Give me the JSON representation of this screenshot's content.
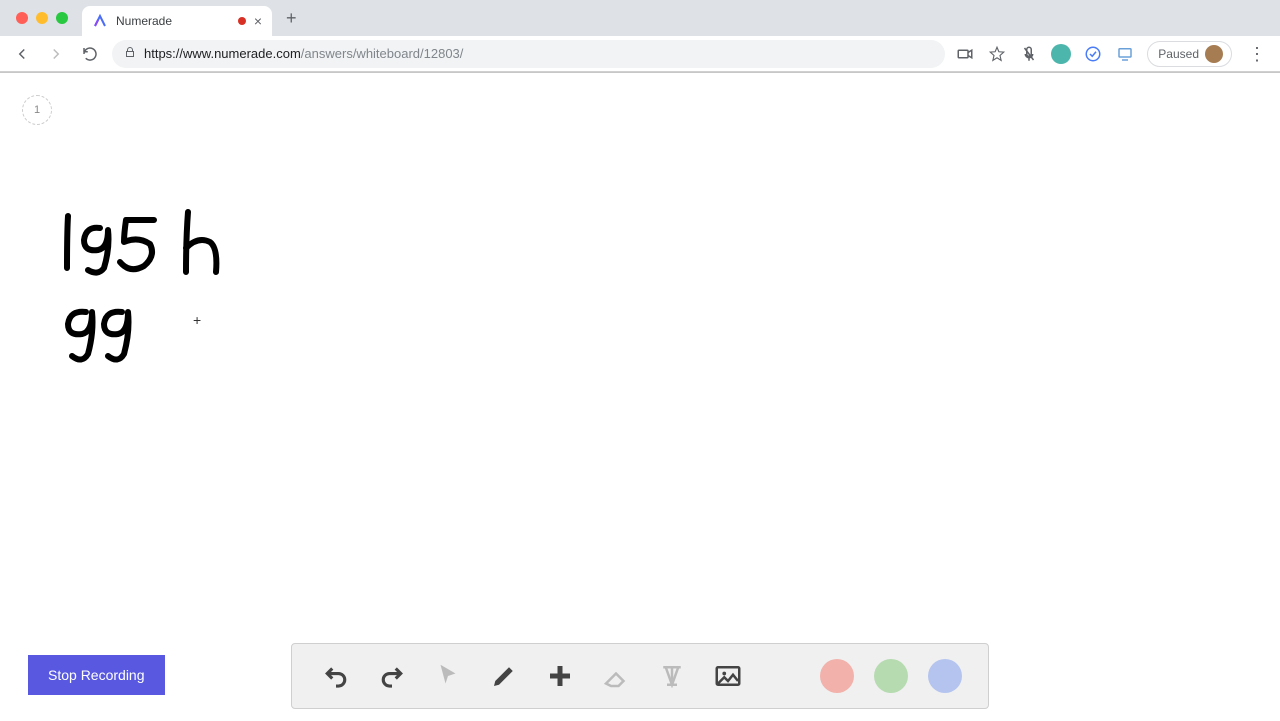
{
  "browser": {
    "tab": {
      "title": "Numerade"
    },
    "url": {
      "host": "https://www.numerade.com",
      "path": "/answers/whiteboard/12803/"
    },
    "paused_label": "Paused"
  },
  "whiteboard": {
    "page_number": "1",
    "handwriting_line1": "195 h",
    "handwriting_line2": "99",
    "stop_recording_label": "Stop Recording"
  },
  "toolbar": {
    "colors": {
      "black": "#000000",
      "red": "#f2b1ab",
      "green": "#b6dbb0",
      "blue": "#b4c4ef"
    }
  }
}
